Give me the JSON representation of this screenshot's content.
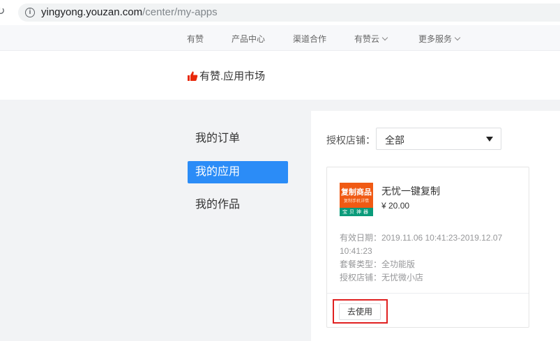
{
  "browser": {
    "url_host": "yingyong.youzan.com",
    "url_path": "/center/my-apps"
  },
  "top_nav": {
    "items": [
      {
        "label": "有赞"
      },
      {
        "label": "产品中心"
      },
      {
        "label": "渠道合作"
      },
      {
        "label": "有赞云"
      },
      {
        "label": "更多服务"
      }
    ]
  },
  "header": {
    "logo_text": "有赞.应用市场"
  },
  "sidebar": {
    "items": [
      {
        "label": "我的订单"
      },
      {
        "label": "我的应用"
      },
      {
        "label": "我的作品"
      }
    ],
    "active_index": 1
  },
  "filter": {
    "label": "授权店铺：",
    "selected": "全部"
  },
  "app_card": {
    "thumb_line1": "复制商品",
    "thumb_line2": "复制手机详情",
    "thumb_line3": "宝贝神器",
    "name": "无忧一键复制",
    "price": "¥ 20.00",
    "validity_line1": "有效日期：2019.11.06 10:41:23-2019.12.07",
    "validity_line2": "10:41:23",
    "package_type": "套餐类型：全功能版",
    "store": "授权店铺：无忧微小店",
    "use_button": "去使用"
  },
  "colors": {
    "accent": "#2b8cf7",
    "highlight": "#e02020",
    "thumb_bg": "#f05a14",
    "thumb_bar": "#0a9b7a"
  }
}
